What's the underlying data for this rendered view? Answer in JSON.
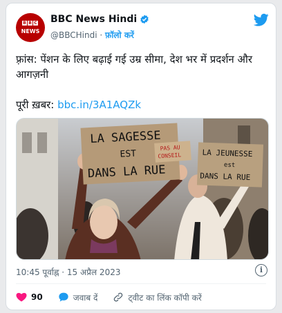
{
  "tweet": {
    "author_name": "BBC News Hindi",
    "handle": "@BBCHindi",
    "separator": "·",
    "follow_label": "फ़ॉलो करें",
    "avatar_logo_letters": [
      "B",
      "B",
      "C"
    ],
    "avatar_logo_word": "NEWS",
    "text_line1": "फ़्रांस: पेंशन के लिए बढ़ाई गई उम्र सीमा, देश भर में प्रदर्शन और आगज़नी",
    "full_story_label": "पूरी ख़बर:",
    "link": "bbc.in/3A1AQZk",
    "timestamp": "10:45 पूर्वाह्न · 15 अप्रैल 2023",
    "info_glyph": "i",
    "image": {
      "sign_left": [
        "LA SAGESSE",
        "EST",
        "DANS LA RUE"
      ],
      "sign_overlay": [
        "PAS AU",
        "CONSEIL"
      ],
      "sign_right": [
        "LA JEUNESSE",
        "est",
        "DANS LA RUE"
      ]
    },
    "actions": {
      "like_count": "90",
      "reply_label": "जवाब दें",
      "copy_link_label": "ट्वीट का लिंक कॉपी करें"
    }
  },
  "colors": {
    "brand_red": "#b80000",
    "twitter_blue": "#1d9bf0",
    "like_red": "#f91880"
  },
  "icons": [
    "bbc-logo",
    "verified-badge-icon",
    "twitter-bird-icon",
    "info-icon",
    "heart-icon",
    "reply-bubble-icon",
    "link-icon"
  ]
}
